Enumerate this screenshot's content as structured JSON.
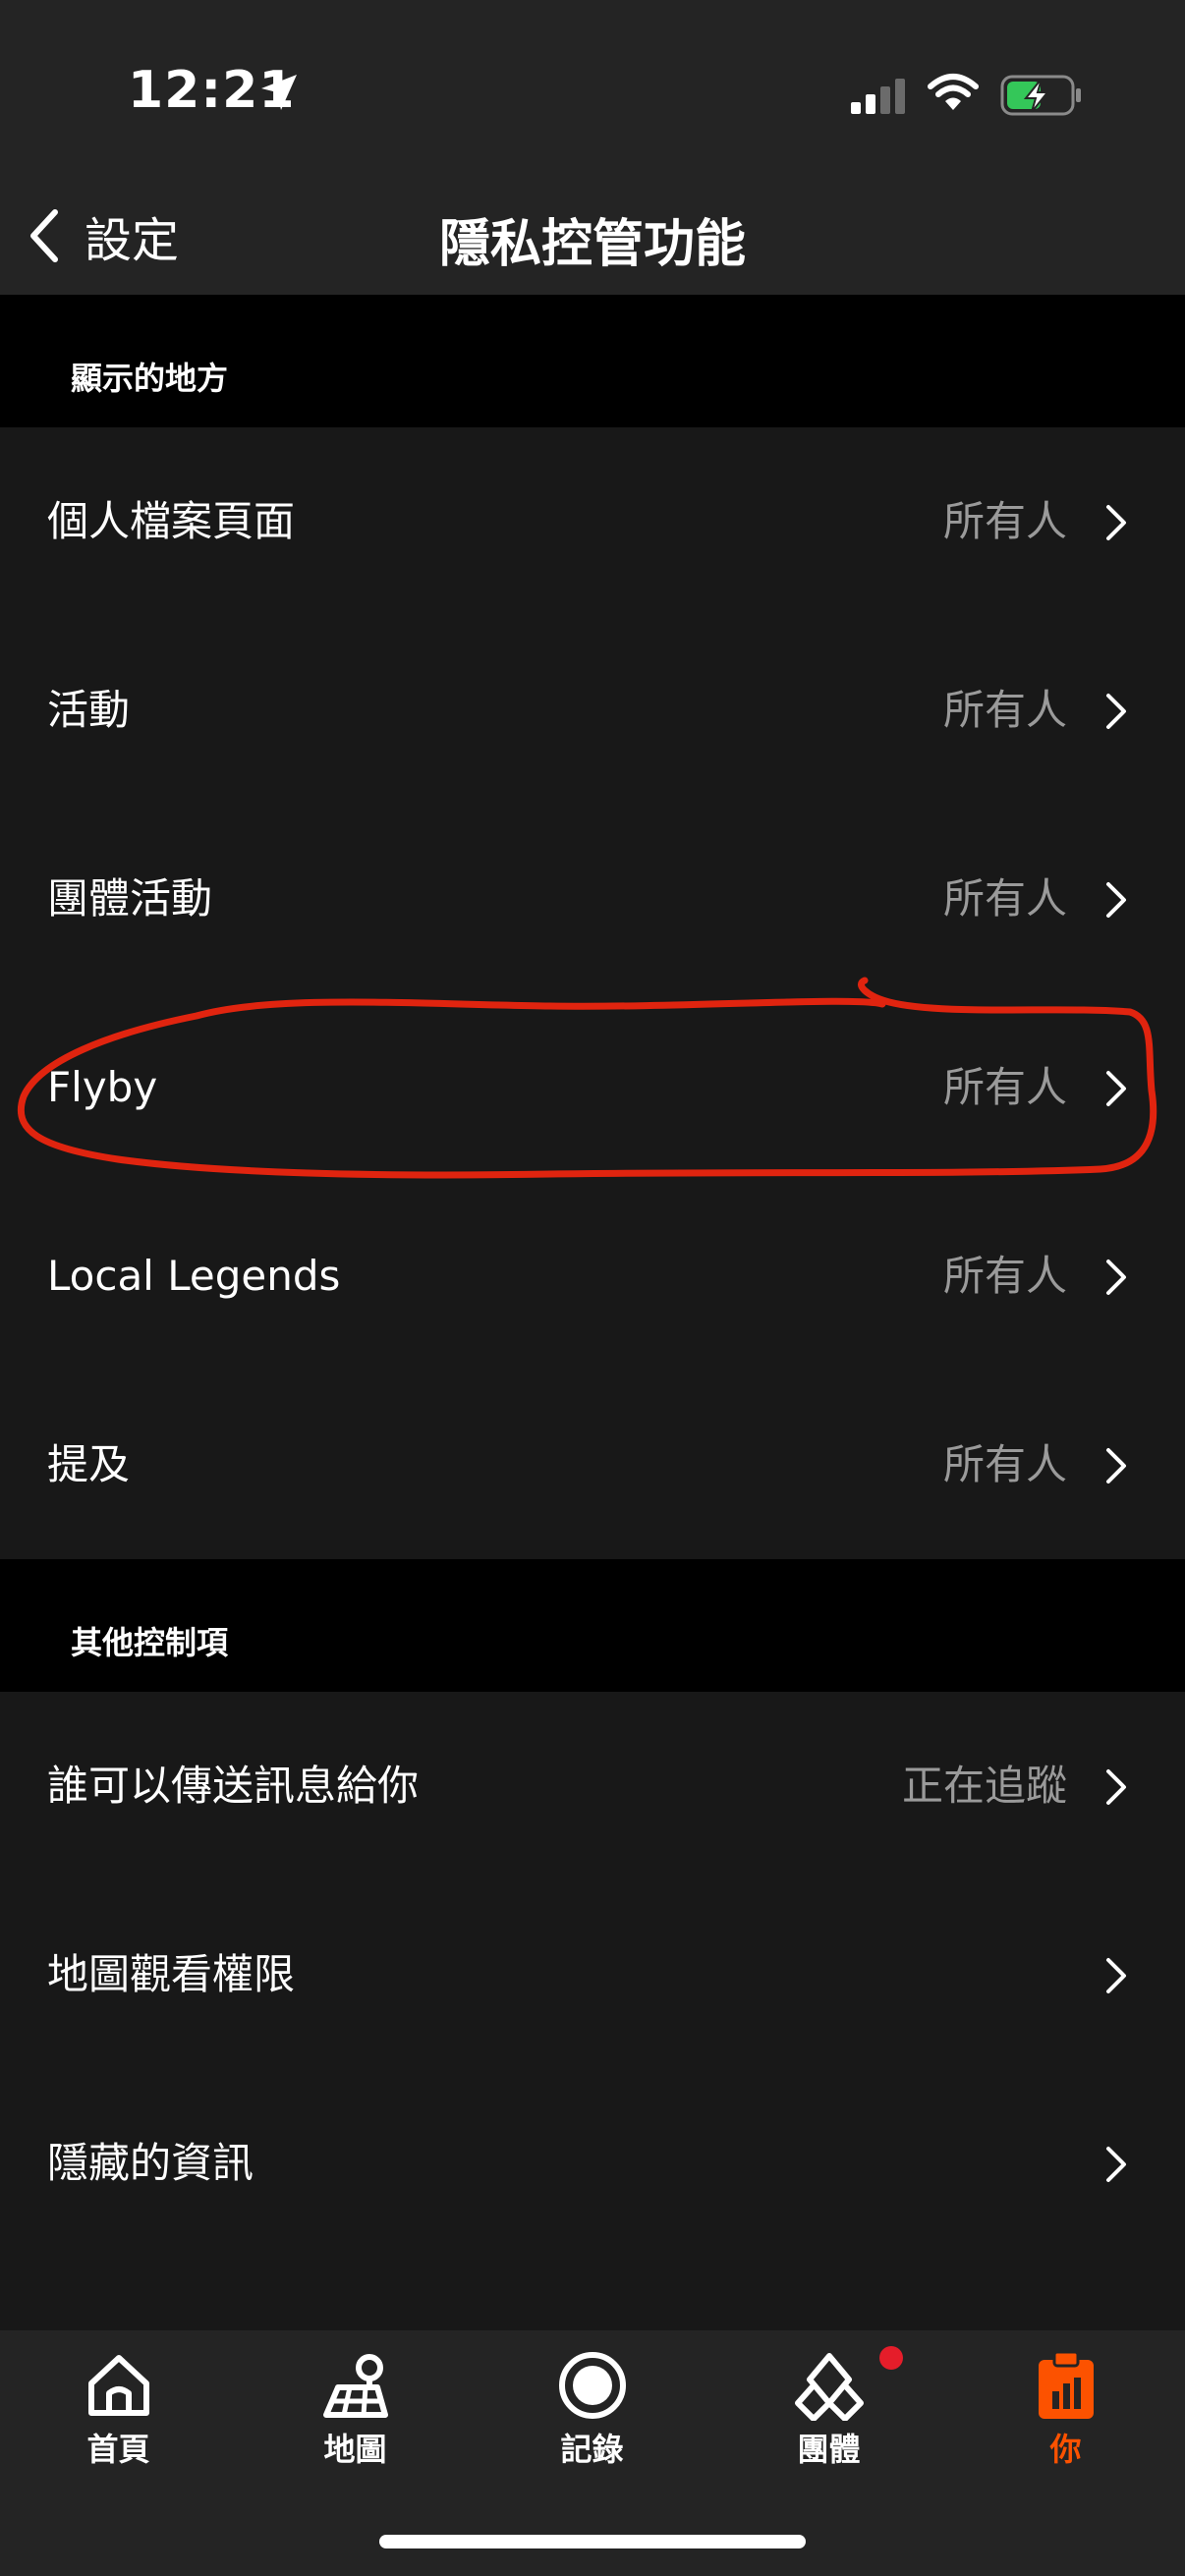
{
  "status_bar": {
    "time": "12:21",
    "icons": [
      "location-arrow-icon",
      "cellular-signal-icon",
      "wifi-icon",
      "battery-charging-icon"
    ]
  },
  "nav": {
    "back_label": "設定",
    "title": "隱私控管功能"
  },
  "sections": [
    {
      "header": "顯示的地方",
      "rows": [
        {
          "label": "個人檔案頁面",
          "value": "所有人"
        },
        {
          "label": "活動",
          "value": "所有人"
        },
        {
          "label": "團體活動",
          "value": "所有人"
        },
        {
          "label": "Flyby",
          "value": "所有人"
        },
        {
          "label": "Local Legends",
          "value": "所有人"
        },
        {
          "label": "提及",
          "value": "所有人"
        }
      ]
    },
    {
      "header": "其他控制項",
      "rows": [
        {
          "label": "誰可以傳送訊息給你",
          "value": "正在追蹤"
        },
        {
          "label": "地圖觀看權限",
          "value": ""
        },
        {
          "label": "隱藏的資訊",
          "value": ""
        }
      ]
    }
  ],
  "tabs": [
    {
      "label": "首頁",
      "icon": "home-icon",
      "active": false
    },
    {
      "label": "地圖",
      "icon": "map-icon",
      "active": false
    },
    {
      "label": "記錄",
      "icon": "record-icon",
      "active": false
    },
    {
      "label": "團體",
      "icon": "groups-icon",
      "active": false,
      "badge": true
    },
    {
      "label": "你",
      "icon": "you-icon",
      "active": true
    }
  ],
  "colors": {
    "accent": "#fc5200",
    "annotation": "#e0240f",
    "badge": "#e51d2a",
    "secondary_text": "#9a9a9a"
  }
}
